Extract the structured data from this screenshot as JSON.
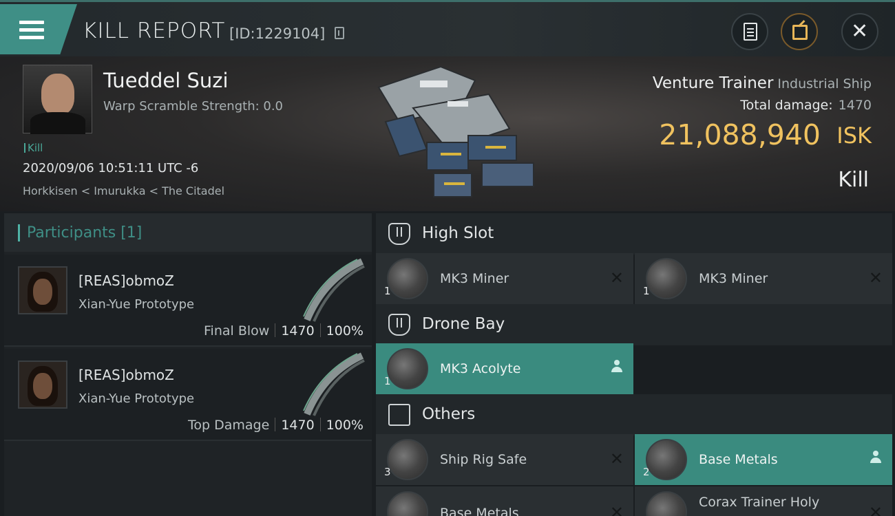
{
  "header": {
    "title": "KILL REPORT",
    "report_id": "[ID:1229104]"
  },
  "victim": {
    "name": "Tueddel Suzi",
    "warp_scramble": "Warp Scramble Strength: 0.0",
    "tag": "Kill",
    "datetime": "2020/09/06 10:51:11 UTC -6",
    "location": "Horkkisen < Imurukka < The Citadel",
    "ship_name": "Venture Trainer",
    "ship_class": "Industrial Ship",
    "total_damage_label": "Total damage:",
    "total_damage_value": "1470",
    "isk_value": "21,088,940",
    "isk_currency": "ISK",
    "result": "Kill"
  },
  "participants": {
    "title": "Participants [1]",
    "rows": [
      {
        "corp": "[REAS]obmoZ",
        "ship": "Xian-Yue Prototype",
        "role": "Final Blow",
        "damage": "1470",
        "percent": "100%"
      },
      {
        "corp": "[REAS]obmoZ",
        "ship": "Xian-Yue Prototype",
        "role": "Top Damage",
        "damage": "1470",
        "percent": "100%"
      }
    ]
  },
  "sections": {
    "high_slot": {
      "title": "High Slot",
      "items": [
        {
          "name": "MK3 Miner",
          "qty": "1",
          "state": "destroyed"
        },
        {
          "name": "MK3 Miner",
          "qty": "1",
          "state": "destroyed"
        }
      ]
    },
    "drone_bay": {
      "title": "Drone Bay",
      "items": [
        {
          "name": "MK3  Acolyte",
          "qty": "1",
          "state": "dropped"
        }
      ]
    },
    "others": {
      "title": "Others",
      "items": [
        {
          "name": "Ship Rig Safe",
          "qty": "3",
          "state": "destroyed"
        },
        {
          "name": "Base Metals",
          "qty": "2",
          "state": "dropped"
        },
        {
          "name": "Base Metals",
          "qty": "",
          "state": "destroyed"
        },
        {
          "name": "Corax Trainer Holy",
          "qty": "",
          "state": "destroyed"
        }
      ]
    }
  },
  "colors": {
    "accent": "#3f8f86",
    "isk": "#f0c25f",
    "highlight_row": "#3a8b7f"
  }
}
